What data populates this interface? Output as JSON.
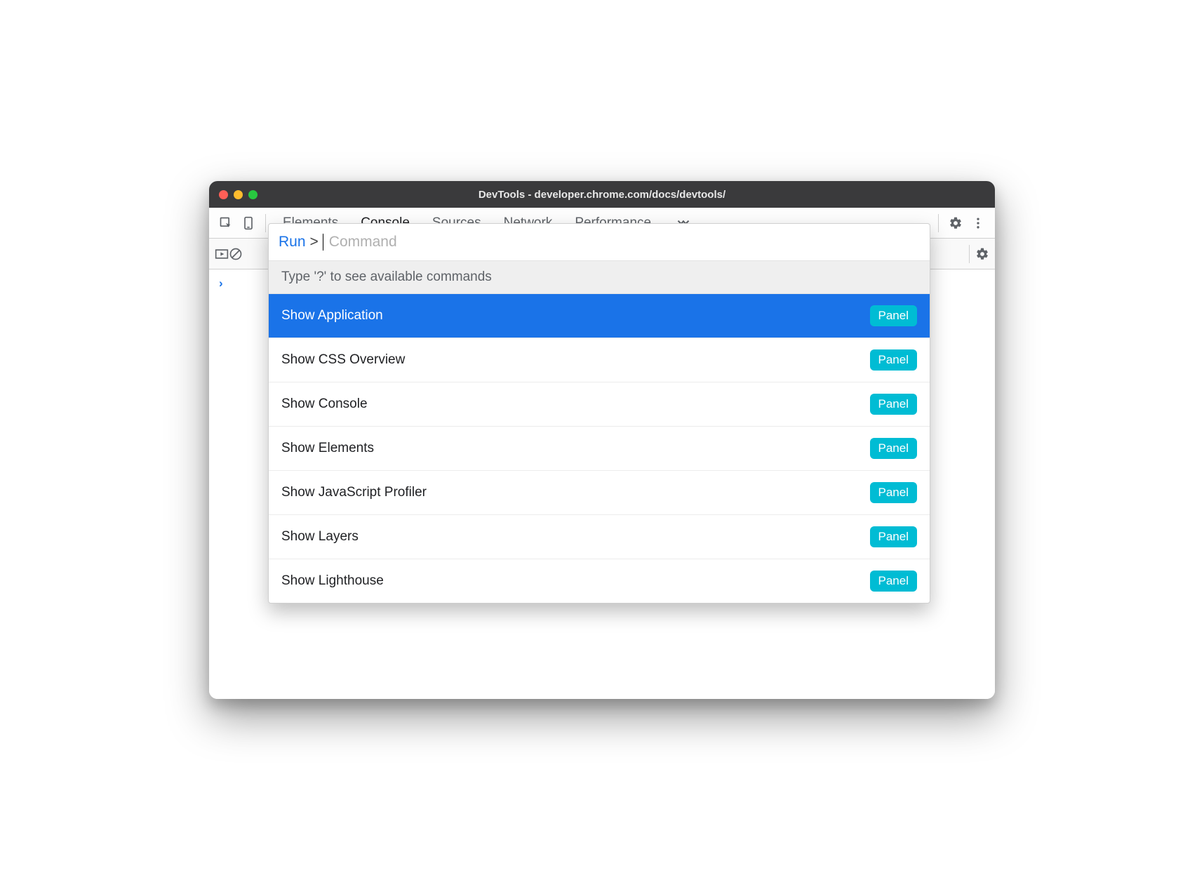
{
  "window": {
    "title": "DevTools - developer.chrome.com/docs/devtools/"
  },
  "toolbar": {
    "tabs": [
      "Elements",
      "Console",
      "Sources",
      "Network",
      "Performance"
    ],
    "active_tab_index": 1
  },
  "command_menu": {
    "run_label": "Run",
    "prompt_symbol": ">",
    "placeholder": "Command",
    "hint": "Type '?' to see available commands",
    "badge_label": "Panel",
    "selected_index": 0,
    "items": [
      {
        "label": "Show Application"
      },
      {
        "label": "Show CSS Overview"
      },
      {
        "label": "Show Console"
      },
      {
        "label": "Show Elements"
      },
      {
        "label": "Show JavaScript Profiler"
      },
      {
        "label": "Show Layers"
      },
      {
        "label": "Show Lighthouse"
      }
    ]
  }
}
